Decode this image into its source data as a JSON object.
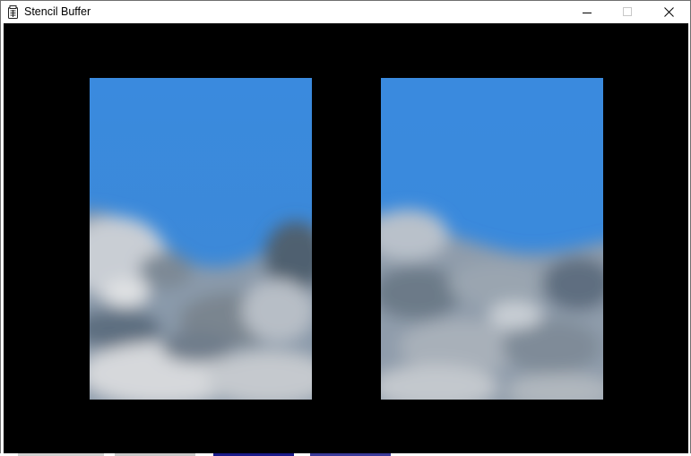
{
  "window": {
    "title": "Stencil Buffer",
    "controls": {
      "minimize_icon": "minimize-icon",
      "maximize_icon": "maximize-icon",
      "close_icon": "close-icon"
    }
  },
  "scene": {
    "background_color": "#000000",
    "sky_color": "#3a8ade",
    "viewports": [
      {
        "name": "left-viewport",
        "content": "sky-with-clouds"
      },
      {
        "name": "right-viewport",
        "content": "sky-with-clouds"
      }
    ]
  }
}
